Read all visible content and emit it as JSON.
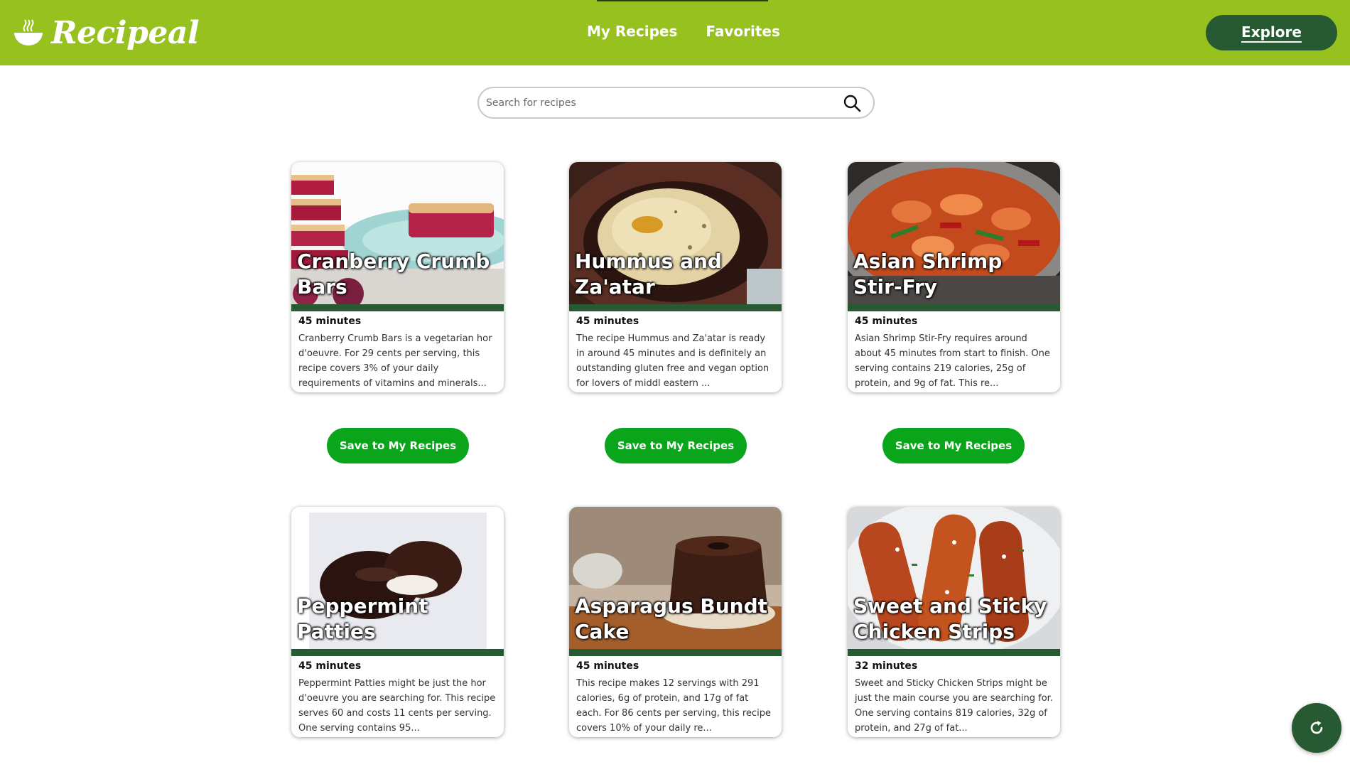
{
  "brand": {
    "name": "Recipeal",
    "logo_icon": "steaming-bowl-icon"
  },
  "nav": {
    "my_recipes": "My Recipes",
    "favorites": "Favorites"
  },
  "explore": {
    "label": "Explore"
  },
  "search": {
    "placeholder": "Search for recipes",
    "icon": "search-icon"
  },
  "colors": {
    "header_bg": "#96c11f",
    "dark_green": "#275a32",
    "save_green": "#0aa51a"
  },
  "recipes": [
    {
      "title": "Cranberry Crumb Bars",
      "time": "45 minutes",
      "description": "Cranberry Crumb Bars is a vegetarian hor d'oeuvre. For 29 cents per serving, this recipe covers 3% of your daily requirements of vitamins and minerals...",
      "save_label": "Save to My Recipes"
    },
    {
      "title": "Hummus and Za'atar",
      "time": "45 minutes",
      "description": "The recipe Hummus and Za'atar is ready in around 45 minutes and is definitely an outstanding gluten free and vegan option for lovers of middl eastern ...",
      "save_label": "Save to My Recipes"
    },
    {
      "title": "Asian Shrimp Stir-Fry",
      "time": "45 minutes",
      "description": "Asian Shrimp Stir-Fry requires around about 45 minutes from start to finish. One serving contains 219 calories, 25g of protein, and 9g of fat. This re...",
      "save_label": "Save to My Recipes"
    },
    {
      "title": "Peppermint Patties",
      "time": "45 minutes",
      "description": "Peppermint Patties might be just the hor d'oeuvre you are searching for. This recipe serves 60 and costs 11 cents per serving. One serving contains 95..."
    },
    {
      "title": "Asparagus Bundt Cake",
      "time": "45 minutes",
      "description": "This recipe makes 12 servings with 291 calories, 6g of protein, and 17g of fat each. For 86 cents per serving, this recipe covers 10% of your daily re..."
    },
    {
      "title": "Sweet and Sticky Chicken Strips",
      "time": "32 minutes",
      "description": "Sweet and Sticky Chicken Strips might be just the main course you are searching for. One serving contains 819 calories, 32g of protein, and 27g of fat..."
    }
  ],
  "refresh": {
    "icon": "refresh-icon"
  }
}
